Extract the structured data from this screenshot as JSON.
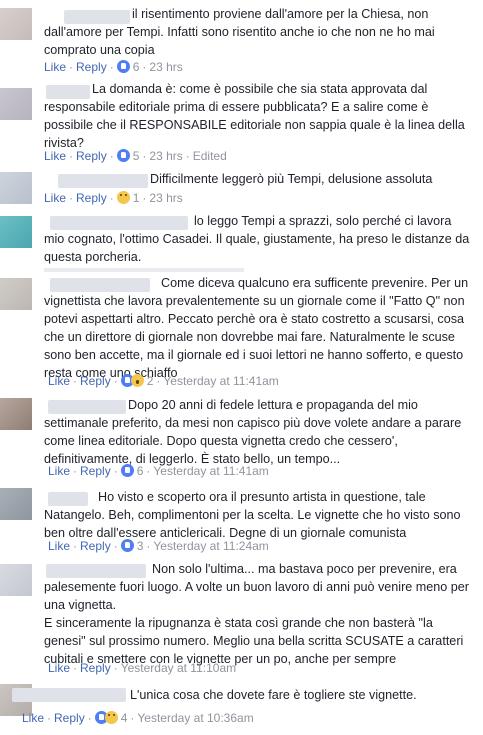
{
  "comments": [
    {
      "text": "il risentimento proviene dall'amore per la Chiesa, non\ndall'amore per Tempi. Infatti sono risentito anche io che non ne ho mai\ncomprato una copia",
      "like": "Like",
      "reply": "Reply",
      "count": "6",
      "time": "23 hrs",
      "edited": ""
    },
    {
      "text": "La domanda è: come è possibile che sia stata approvata dal\nresponsabile editoriale prima di essere pubblicata? E a salire come è\npossibile che il RESPONSABILE editoriale non sappia quale è la linea della\nrivista?",
      "like": "Like",
      "reply": "Reply",
      "count": "5",
      "time": "23 hrs",
      "edited": "Edited"
    },
    {
      "text": "Difficilmente leggerò più Tempi, delusione assoluta",
      "like": "Like",
      "reply": "Reply",
      "count": "1",
      "time": "23 hrs",
      "edited": ""
    },
    {
      "text": "lo leggo Tempi a sprazzi, solo perché ci lavora\nmio cognato, l'ottimo Casadei. Il quale, giustamente, ha preso le distanze da\nquesta porcheria.",
      "like": "",
      "reply": "",
      "count": "",
      "time": "",
      "edited": ""
    },
    {
      "text": "Come diceva qualcuno era sufficente prevenire. Per un\nvignettista che lavora prevalentemente su un giornale come il \"Fatto Q\" non\npotevi aspettarti altro. Peccato perchè ora è stato costretto a scusarsi, cosa\nche un direttore di giornale non dovrebbe mai fare. Naturalmente le scuse\nsono ben accette, ma il giornale ed i suoi lettori ne hanno sofferto, e questo\nresta come uno schiaffo",
      "like": "Like",
      "reply": "Reply",
      "count": "2",
      "time": "Yesterday at 11:41am",
      "edited": ""
    },
    {
      "text": "Dopo 20 anni di fedele lettura e propaganda del mio\nsettimanale preferito, da mesi non capisco più dove volete andare a parare\ncome linea editoriale. Dopo questa vignetta credo che cessero',\ndefinitivamente, di leggerlo. È stato bello, un tempo...",
      "like": "Like",
      "reply": "Reply",
      "count": "6",
      "time": "Yesterday at 11:41am",
      "edited": ""
    },
    {
      "text": "Ho visto e scoperto ora il presunto artista in questione, tale\nNatangelo. Beh, complimentoni per la scelta. Le vignette che ho visto sono\nben oltre dall'essere anticlericali. Degne di un giornale comunista",
      "like": "Like",
      "reply": "Reply",
      "count": "3",
      "time": "Yesterday at 11:24am",
      "edited": ""
    },
    {
      "text": "Non solo l'ultima... ma bastava poco per prevenire, era\npalesemente fuori luogo. A volte un buon lavoro di anni può venire meno per\nuna vignetta.\nE sinceramente la ripugnanza è stata così grande che non basterà \"la\ngenesi\" sul prossimo numero. Meglio una bella scritta SCUSATE a caratteri\ncubitali e smettere con le vignette per un po, anche per sempre",
      "like": "Like",
      "reply": "Reply",
      "count": "",
      "time": "Yesterday at 11:10am",
      "edited": ""
    },
    {
      "text": "L'unica cosa che dovete fare è togliere ste vignette.",
      "like": "Like",
      "reply": "Reply",
      "count": "4",
      "time": "Yesterday at 10:36am",
      "edited": ""
    }
  ],
  "colors": {
    "link": "#4267b2",
    "meta": "#90949c",
    "text": "#1d2129",
    "like_reaction": "#4f7ef5"
  },
  "icons": [
    "like-reaction-icon",
    "sad-reaction-icon",
    "wow-reaction-icon"
  ]
}
